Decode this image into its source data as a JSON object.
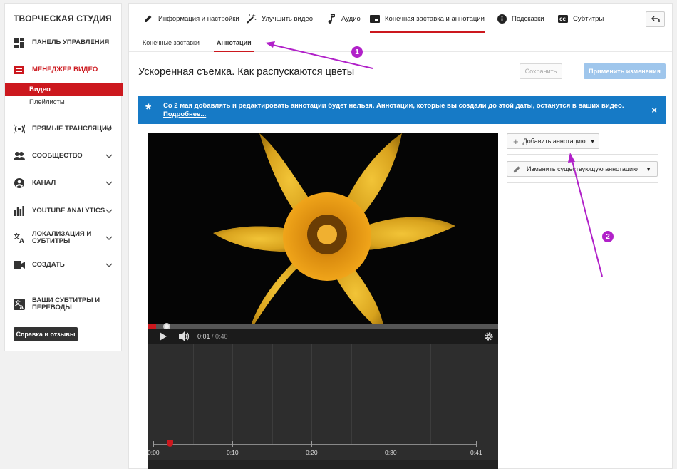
{
  "sidebar": {
    "title": "ТВОРЧЕСКАЯ СТУДИЯ",
    "dashboard": "ПАНЕЛЬ УПРАВЛЕНИЯ",
    "video_manager": "МЕНЕДЖЕР ВИДЕО",
    "sub_videos": "Видео",
    "sub_playlists": "Плейлисты",
    "live": "ПРЯМЫЕ ТРАНСЛЯЦИИ",
    "community": "СООБЩЕСТВО",
    "channel": "КАНАЛ",
    "analytics": "YOUTUBE ANALYTICS",
    "localization_1": "ЛОКАЛИЗАЦИЯ И",
    "localization_2": "СУБТИТРЫ",
    "create": "СОЗДАТЬ",
    "your_subs_1": "ВАШИ СУБТИТРЫ И",
    "your_subs_2": "ПЕРЕВОДЫ",
    "feedback": "Справка и отзывы"
  },
  "tabs": {
    "info": "Информация и настройки",
    "enhance": "Улучшить видео",
    "audio": "Аудио",
    "endscreen": "Конечная заставка и аннотации",
    "cards": "Подсказки",
    "subtitles": "Субтитры"
  },
  "subtabs": {
    "endscreens": "Конечные заставки",
    "annotations": "Аннотации"
  },
  "video": {
    "title": "Ускоренная съемка. Как распускаются цветы",
    "save": "Сохранить",
    "apply": "Применить изменения"
  },
  "notice": {
    "text": "Со 2 мая добавлять и редактировать аннотации будет нельзя. Аннотации, которые вы создали до этой даты, останутся в ваших видео.",
    "more": "Подробнее...",
    "close": "×"
  },
  "player": {
    "current_time": "0:01",
    "separator": " / ",
    "total_time": "0:40",
    "progress_fraction": 0.025
  },
  "timeline": {
    "labels": [
      "0:00",
      "0:10",
      "0:20",
      "0:30",
      "0:41"
    ]
  },
  "panel": {
    "add_annotation": "Добавить аннотацию",
    "edit_annotation": "Изменить существующую аннотацию"
  },
  "callouts": {
    "one": "1",
    "two": "2"
  },
  "colors": {
    "accent": "#cc181e",
    "notice": "#167ac6",
    "callout": "#b121c9"
  }
}
